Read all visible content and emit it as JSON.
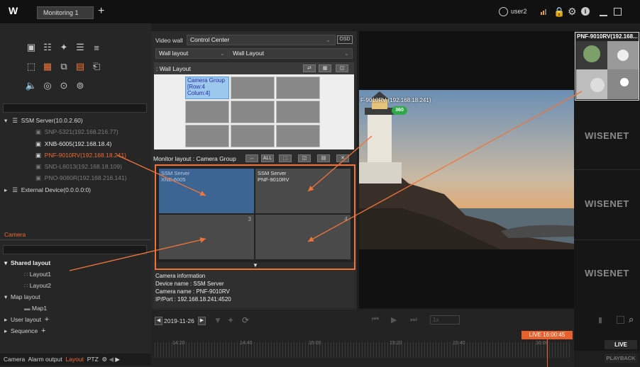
{
  "header": {
    "logo": "W",
    "tab": "Monitoring 1",
    "add": "+",
    "user": "user2",
    "icons": [
      "user-icon",
      "signal-icon",
      "lock-icon",
      "gear-icon",
      "info-icon",
      "minimize-icon",
      "maximize-icon"
    ]
  },
  "left_panel": {
    "toolbar_icons": [
      "camera-icon",
      "print-icon",
      "sync-icon",
      "layout-icon",
      "list-icon",
      "fullscreen-icon",
      "grid-icon",
      "copy-icon",
      "monitor-icon",
      "export-icon",
      "speaker-icon",
      "headset-icon",
      "microphone-icon",
      "mic-alt-icon"
    ],
    "tree": [
      {
        "label": "SSM Server(10.0.2.60)",
        "color": "#d9d9d9",
        "level": 0
      },
      {
        "label": "SNP-5321(192.168.216.77)",
        "color": "#7d7d7d",
        "level": 1
      },
      {
        "label": "XNB-6005(192.168.18.4)",
        "color": "#e6e6e6",
        "level": 1
      },
      {
        "label": "PNF-9010RV(192.168.18.241)",
        "color": "#ee6a34",
        "level": 1
      },
      {
        "label": "SND-L6013(192.168.18.109)",
        "color": "#7d7d7d",
        "level": 1
      },
      {
        "label": "PNO-9080R(192.168.216.141)",
        "color": "#7d7d7d",
        "level": 1
      },
      {
        "label": "External Device(0.0.0.0:0)",
        "color": "#d9d9d9",
        "level": 0
      }
    ],
    "section_tab": "Camera",
    "layout_tree": [
      {
        "label": "Shared layout",
        "level": 0,
        "bold": true
      },
      {
        "label": "Layout1",
        "level": 1
      },
      {
        "label": "Layout2",
        "level": 1
      },
      {
        "label": "Map layout",
        "level": 0
      },
      {
        "label": "Map1",
        "level": 1
      },
      {
        "label": "User layout",
        "level": 0,
        "plus": "+"
      },
      {
        "label": "Sequence",
        "level": 0,
        "plus": "+"
      }
    ],
    "bottom_tabs": [
      "Camera",
      "Alarm output",
      "Layout",
      "PTZ"
    ]
  },
  "video_wall": {
    "label": "Video wall",
    "value": "Control Center",
    "osd": "OSD",
    "layout_select": "Wall layout",
    "layout_value": "Wall Layout",
    "section": ": Wall Layout",
    "group_text": [
      "Camera Group",
      "[Row:4",
      "Colum:4]"
    ],
    "monitor_label": "Monitor layout : Camera Group",
    "toolbar": [
      "ALL"
    ],
    "cells": [
      {
        "l1": "SSM Server",
        "l2": "XNB-6005",
        "num": ""
      },
      {
        "l1": "SSM Server",
        "l2": "PNF-9010RV",
        "num": ""
      },
      {
        "l1": "",
        "l2": "",
        "num": "3"
      },
      {
        "l1": "",
        "l2": "",
        "num": "4"
      }
    ],
    "info_title": "Camera information",
    "info": [
      "Device name : SSM Server",
      "Camera name : PNF-9010RV",
      "IP/Port : 192.168.18.241:4520"
    ]
  },
  "viewer": {
    "overlay": "F-9010RV (192.168.18.241)",
    "badge": "360"
  },
  "right_strip": {
    "title": "PNF-9010RV(192.168...",
    "brand": "WISENET"
  },
  "timeline": {
    "date": "2019-11-26",
    "speed": "1x",
    "live_badge": "LIVE 16:00:45",
    "ticks": [
      "14:20",
      "14:40",
      "15:00",
      "15:20",
      "15:40",
      "16:00"
    ],
    "live": "LIVE",
    "playback": "PLAYBACK"
  }
}
